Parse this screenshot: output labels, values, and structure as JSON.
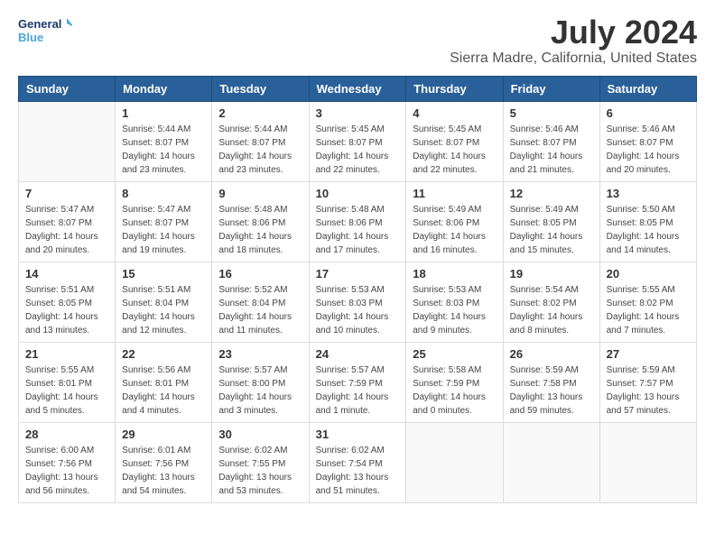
{
  "logo": {
    "line1": "General",
    "line2": "Blue"
  },
  "title": "July 2024",
  "location": "Sierra Madre, California, United States",
  "headers": [
    "Sunday",
    "Monday",
    "Tuesday",
    "Wednesday",
    "Thursday",
    "Friday",
    "Saturday"
  ],
  "weeks": [
    [
      {
        "day": "",
        "info": ""
      },
      {
        "day": "1",
        "info": "Sunrise: 5:44 AM\nSunset: 8:07 PM\nDaylight: 14 hours\nand 23 minutes."
      },
      {
        "day": "2",
        "info": "Sunrise: 5:44 AM\nSunset: 8:07 PM\nDaylight: 14 hours\nand 23 minutes."
      },
      {
        "day": "3",
        "info": "Sunrise: 5:45 AM\nSunset: 8:07 PM\nDaylight: 14 hours\nand 22 minutes."
      },
      {
        "day": "4",
        "info": "Sunrise: 5:45 AM\nSunset: 8:07 PM\nDaylight: 14 hours\nand 22 minutes."
      },
      {
        "day": "5",
        "info": "Sunrise: 5:46 AM\nSunset: 8:07 PM\nDaylight: 14 hours\nand 21 minutes."
      },
      {
        "day": "6",
        "info": "Sunrise: 5:46 AM\nSunset: 8:07 PM\nDaylight: 14 hours\nand 20 minutes."
      }
    ],
    [
      {
        "day": "7",
        "info": "Sunrise: 5:47 AM\nSunset: 8:07 PM\nDaylight: 14 hours\nand 20 minutes."
      },
      {
        "day": "8",
        "info": "Sunrise: 5:47 AM\nSunset: 8:07 PM\nDaylight: 14 hours\nand 19 minutes."
      },
      {
        "day": "9",
        "info": "Sunrise: 5:48 AM\nSunset: 8:06 PM\nDaylight: 14 hours\nand 18 minutes."
      },
      {
        "day": "10",
        "info": "Sunrise: 5:48 AM\nSunset: 8:06 PM\nDaylight: 14 hours\nand 17 minutes."
      },
      {
        "day": "11",
        "info": "Sunrise: 5:49 AM\nSunset: 8:06 PM\nDaylight: 14 hours\nand 16 minutes."
      },
      {
        "day": "12",
        "info": "Sunrise: 5:49 AM\nSunset: 8:05 PM\nDaylight: 14 hours\nand 15 minutes."
      },
      {
        "day": "13",
        "info": "Sunrise: 5:50 AM\nSunset: 8:05 PM\nDaylight: 14 hours\nand 14 minutes."
      }
    ],
    [
      {
        "day": "14",
        "info": "Sunrise: 5:51 AM\nSunset: 8:05 PM\nDaylight: 14 hours\nand 13 minutes."
      },
      {
        "day": "15",
        "info": "Sunrise: 5:51 AM\nSunset: 8:04 PM\nDaylight: 14 hours\nand 12 minutes."
      },
      {
        "day": "16",
        "info": "Sunrise: 5:52 AM\nSunset: 8:04 PM\nDaylight: 14 hours\nand 11 minutes."
      },
      {
        "day": "17",
        "info": "Sunrise: 5:53 AM\nSunset: 8:03 PM\nDaylight: 14 hours\nand 10 minutes."
      },
      {
        "day": "18",
        "info": "Sunrise: 5:53 AM\nSunset: 8:03 PM\nDaylight: 14 hours\nand 9 minutes."
      },
      {
        "day": "19",
        "info": "Sunrise: 5:54 AM\nSunset: 8:02 PM\nDaylight: 14 hours\nand 8 minutes."
      },
      {
        "day": "20",
        "info": "Sunrise: 5:55 AM\nSunset: 8:02 PM\nDaylight: 14 hours\nand 7 minutes."
      }
    ],
    [
      {
        "day": "21",
        "info": "Sunrise: 5:55 AM\nSunset: 8:01 PM\nDaylight: 14 hours\nand 5 minutes."
      },
      {
        "day": "22",
        "info": "Sunrise: 5:56 AM\nSunset: 8:01 PM\nDaylight: 14 hours\nand 4 minutes."
      },
      {
        "day": "23",
        "info": "Sunrise: 5:57 AM\nSunset: 8:00 PM\nDaylight: 14 hours\nand 3 minutes."
      },
      {
        "day": "24",
        "info": "Sunrise: 5:57 AM\nSunset: 7:59 PM\nDaylight: 14 hours\nand 1 minute."
      },
      {
        "day": "25",
        "info": "Sunrise: 5:58 AM\nSunset: 7:59 PM\nDaylight: 14 hours\nand 0 minutes."
      },
      {
        "day": "26",
        "info": "Sunrise: 5:59 AM\nSunset: 7:58 PM\nDaylight: 13 hours\nand 59 minutes."
      },
      {
        "day": "27",
        "info": "Sunrise: 5:59 AM\nSunset: 7:57 PM\nDaylight: 13 hours\nand 57 minutes."
      }
    ],
    [
      {
        "day": "28",
        "info": "Sunrise: 6:00 AM\nSunset: 7:56 PM\nDaylight: 13 hours\nand 56 minutes."
      },
      {
        "day": "29",
        "info": "Sunrise: 6:01 AM\nSunset: 7:56 PM\nDaylight: 13 hours\nand 54 minutes."
      },
      {
        "day": "30",
        "info": "Sunrise: 6:02 AM\nSunset: 7:55 PM\nDaylight: 13 hours\nand 53 minutes."
      },
      {
        "day": "31",
        "info": "Sunrise: 6:02 AM\nSunset: 7:54 PM\nDaylight: 13 hours\nand 51 minutes."
      },
      {
        "day": "",
        "info": ""
      },
      {
        "day": "",
        "info": ""
      },
      {
        "day": "",
        "info": ""
      }
    ]
  ]
}
